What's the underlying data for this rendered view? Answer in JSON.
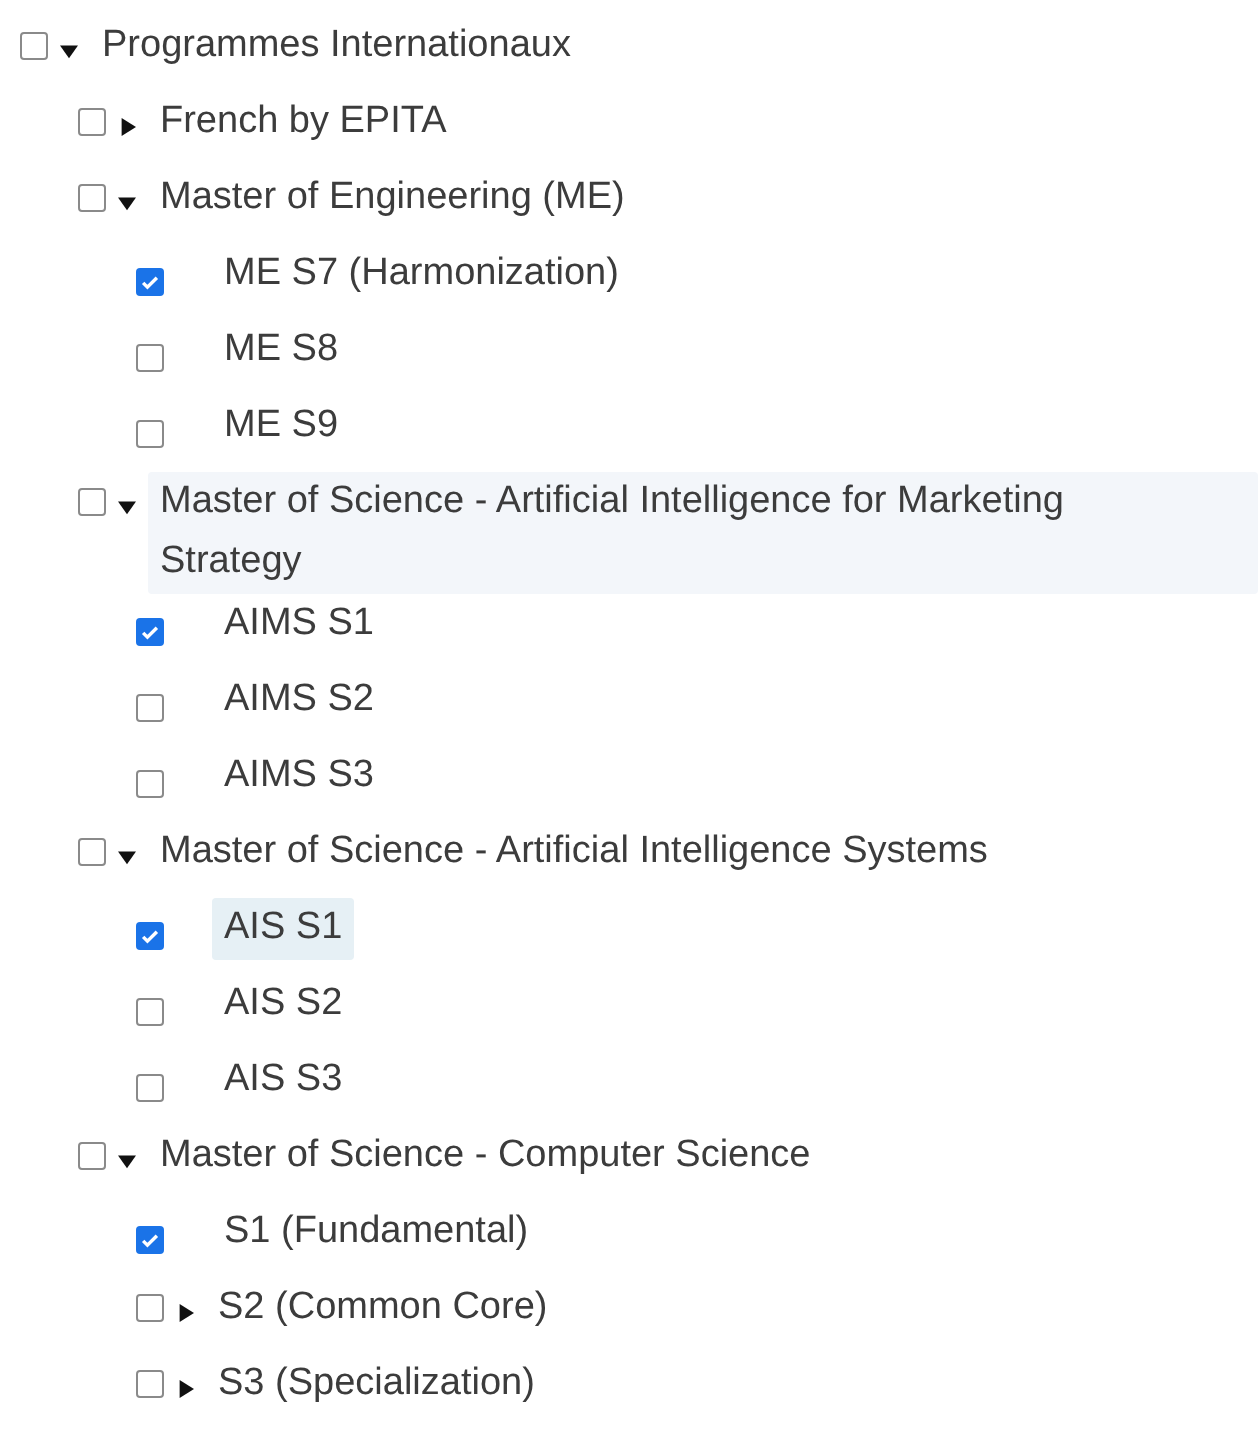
{
  "tree": [
    {
      "kind": "branch",
      "label": "Programmes Internationaux",
      "checked": false,
      "expanded": true,
      "selected": false,
      "hovered": false,
      "children": [
        {
          "kind": "branch",
          "label": "French by EPITA",
          "checked": false,
          "expanded": false,
          "selected": false,
          "hovered": false
        },
        {
          "kind": "branch",
          "label": "Master of Engineering (ME)",
          "checked": false,
          "expanded": true,
          "selected": false,
          "hovered": false,
          "children": [
            {
              "kind": "leaf",
              "label": "ME S7 (Harmonization)",
              "checked": true,
              "selected": false,
              "hovered": false
            },
            {
              "kind": "leaf",
              "label": "ME S8",
              "checked": false,
              "selected": false,
              "hovered": false
            },
            {
              "kind": "leaf",
              "label": "ME S9",
              "checked": false,
              "selected": false,
              "hovered": false
            }
          ]
        },
        {
          "kind": "branch",
          "label": "Master of Science - Artificial Intelligence for Marketing Strategy",
          "checked": false,
          "expanded": true,
          "selected": false,
          "hovered": true,
          "children": [
            {
              "kind": "leaf",
              "label": "AIMS S1",
              "checked": true,
              "selected": false,
              "hovered": false
            },
            {
              "kind": "leaf",
              "label": "AIMS S2",
              "checked": false,
              "selected": false,
              "hovered": false
            },
            {
              "kind": "leaf",
              "label": "AIMS S3",
              "checked": false,
              "selected": false,
              "hovered": false
            }
          ]
        },
        {
          "kind": "branch",
          "label": "Master of Science - Artificial Intelligence Systems",
          "checked": false,
          "expanded": true,
          "selected": false,
          "hovered": false,
          "children": [
            {
              "kind": "leaf",
              "label": "AIS S1",
              "checked": true,
              "selected": true,
              "hovered": false
            },
            {
              "kind": "leaf",
              "label": "AIS S2",
              "checked": false,
              "selected": false,
              "hovered": false
            },
            {
              "kind": "leaf",
              "label": "AIS S3",
              "checked": false,
              "selected": false,
              "hovered": false
            }
          ]
        },
        {
          "kind": "branch",
          "label": "Master of Science - Computer Science",
          "checked": false,
          "expanded": true,
          "selected": false,
          "hovered": false,
          "children": [
            {
              "kind": "leaf",
              "label": "S1 (Fundamental)",
              "checked": true,
              "selected": false,
              "hovered": false
            },
            {
              "kind": "branch",
              "label": "S2 (Common Core)",
              "checked": false,
              "expanded": false,
              "selected": false,
              "hovered": false
            },
            {
              "kind": "branch",
              "label": "S3 (Specialization)",
              "checked": false,
              "expanded": false,
              "selected": false,
              "hovered": false
            }
          ]
        }
      ]
    }
  ]
}
